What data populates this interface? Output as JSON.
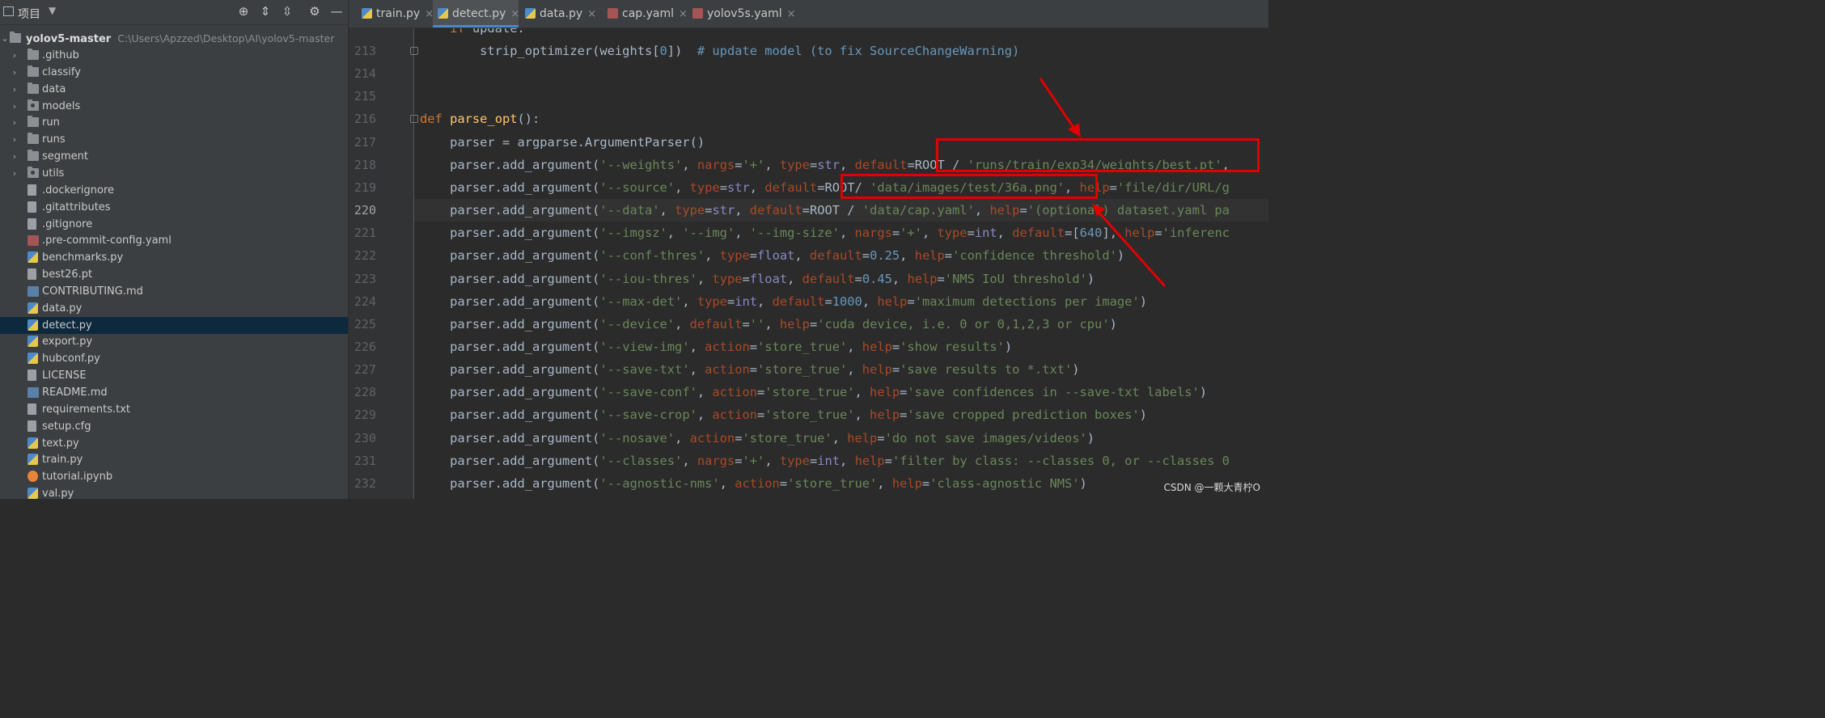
{
  "project_panel": {
    "title": "项目",
    "root": {
      "name": "yolov5-master",
      "path": "C:\\Users\\Apzzed\\Desktop\\AI\\yolov5-master"
    },
    "items": [
      {
        "name": ".github",
        "kind": "folder"
      },
      {
        "name": "classify",
        "kind": "folder"
      },
      {
        "name": "data",
        "kind": "folder"
      },
      {
        "name": "models",
        "kind": "package"
      },
      {
        "name": "run",
        "kind": "folder"
      },
      {
        "name": "runs",
        "kind": "folder"
      },
      {
        "name": "segment",
        "kind": "folder"
      },
      {
        "name": "utils",
        "kind": "package"
      },
      {
        "name": ".dockerignore",
        "kind": "file"
      },
      {
        "name": ".gitattributes",
        "kind": "file"
      },
      {
        "name": ".gitignore",
        "kind": "file"
      },
      {
        "name": ".pre-commit-config.yaml",
        "kind": "yaml"
      },
      {
        "name": "benchmarks.py",
        "kind": "python"
      },
      {
        "name": "best26.pt",
        "kind": "file"
      },
      {
        "name": "CONTRIBUTING.md",
        "kind": "markdown"
      },
      {
        "name": "data.py",
        "kind": "python"
      },
      {
        "name": "detect.py",
        "kind": "python",
        "selected": true
      },
      {
        "name": "export.py",
        "kind": "python"
      },
      {
        "name": "hubconf.py",
        "kind": "python"
      },
      {
        "name": "LICENSE",
        "kind": "file"
      },
      {
        "name": "README.md",
        "kind": "markdown"
      },
      {
        "name": "requirements.txt",
        "kind": "file"
      },
      {
        "name": "setup.cfg",
        "kind": "file"
      },
      {
        "name": "text.py",
        "kind": "python"
      },
      {
        "name": "train.py",
        "kind": "python"
      },
      {
        "name": "tutorial.ipynb",
        "kind": "notebook"
      },
      {
        "name": "val.py",
        "kind": "python"
      }
    ]
  },
  "tabs": [
    {
      "label": "train.py",
      "kind": "py"
    },
    {
      "label": "detect.py",
      "kind": "py",
      "active": true
    },
    {
      "label": "data.py",
      "kind": "py"
    },
    {
      "label": "cap.yaml",
      "kind": "yml"
    },
    {
      "label": "yolov5s.yaml",
      "kind": "yml"
    }
  ],
  "editor": {
    "current_line": "220",
    "lines": [
      {
        "n": "213",
        "text": "        strip_optimizer(weights[0])  # update model (to fix SourceChangeWarning)"
      },
      {
        "n": "214",
        "text": ""
      },
      {
        "n": "215",
        "text": ""
      },
      {
        "n": "216",
        "text": "def parse_opt():"
      },
      {
        "n": "217",
        "text": "    parser = argparse.ArgumentParser()"
      },
      {
        "n": "218",
        "text": "    parser.add_argument('--weights', nargs='+', type=str, default=ROOT / 'runs/train/exp34/weights/best.pt',"
      },
      {
        "n": "219",
        "text": "    parser.add_argument('--source', type=str, default=ROOT/ 'data/images/test/36a.png', help='file/dir/URL/g"
      },
      {
        "n": "220",
        "text": "    parser.add_argument('--data', type=str, default=ROOT / 'data/cap.yaml', help='(optional) dataset.yaml pa"
      },
      {
        "n": "221",
        "text": "    parser.add_argument('--imgsz', '--img', '--img-size', nargs='+', type=int, default=[640], help='inferenc"
      },
      {
        "n": "222",
        "text": "    parser.add_argument('--conf-thres', type=float, default=0.25, help='confidence threshold')"
      },
      {
        "n": "223",
        "text": "    parser.add_argument('--iou-thres', type=float, default=0.45, help='NMS IoU threshold')"
      },
      {
        "n": "224",
        "text": "    parser.add_argument('--max-det', type=int, default=1000, help='maximum detections per image')"
      },
      {
        "n": "225",
        "text": "    parser.add_argument('--device', default='', help='cuda device, i.e. 0 or 0,1,2,3 or cpu')"
      },
      {
        "n": "226",
        "text": "    parser.add_argument('--view-img', action='store_true', help='show results')"
      },
      {
        "n": "227",
        "text": "    parser.add_argument('--save-txt', action='store_true', help='save results to *.txt')"
      },
      {
        "n": "228",
        "text": "    parser.add_argument('--save-conf', action='store_true', help='save confidences in --save-txt labels')"
      },
      {
        "n": "229",
        "text": "    parser.add_argument('--save-crop', action='store_true', help='save cropped prediction boxes')"
      },
      {
        "n": "230",
        "text": "    parser.add_argument('--nosave', action='store_true', help='do not save images/videos')"
      },
      {
        "n": "231",
        "text": "    parser.add_argument('--classes', nargs='+', type=int, help='filter by class: --classes 0, or --classes 0"
      },
      {
        "n": "232",
        "text": "    parser.add_argument('--agnostic-nms', action='store_true', help='class-agnostic NMS')"
      }
    ]
  },
  "watermark": "CSDN @一颗大青柠O",
  "colors": {
    "annotation": "#e00000",
    "selection": "#0d293e",
    "tab_underline": "#4a88c7"
  }
}
